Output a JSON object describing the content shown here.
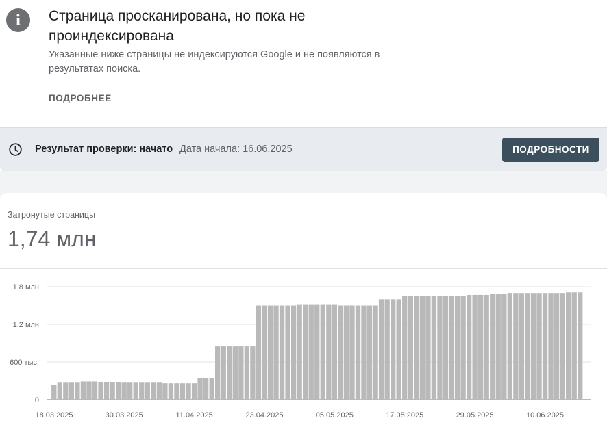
{
  "notice": {
    "title": "Страница просканирована, но пока не проиндексирована",
    "description": "Указанные ниже страницы не индексируются Google и не появляются в результатах поиска.",
    "more_link": "ПОДРОБНЕЕ",
    "icon": "info-icon"
  },
  "validation": {
    "status_label": "Результат проверки: начато",
    "start_date": "Дата начала: 16.06.2025",
    "details_button": "ПОДРОБНОСТИ",
    "icon": "clock-icon"
  },
  "metric": {
    "label": "Затронутые страницы",
    "value": "1,74 млн"
  },
  "colors": {
    "bar": "#b9b9b9",
    "button": "#3c4f5d",
    "status_bg": "#e8ebef"
  },
  "chart_data": {
    "type": "bar",
    "title": "",
    "xlabel": "",
    "ylabel": "",
    "ylim": [
      0,
      1800000
    ],
    "grid": true,
    "y_ticks": [
      {
        "value": 0,
        "label": "0"
      },
      {
        "value": 600000,
        "label": "600 тыс."
      },
      {
        "value": 1200000,
        "label": "1,2 млн"
      },
      {
        "value": 1800000,
        "label": "1,8 млн"
      }
    ],
    "x_tick_labels": [
      {
        "index": 0,
        "label": "18.03.2025"
      },
      {
        "index": 12,
        "label": "30.03.2025"
      },
      {
        "index": 24,
        "label": "11.04.2025"
      },
      {
        "index": 36,
        "label": "23.04.2025"
      },
      {
        "index": 48,
        "label": "05.05.2025"
      },
      {
        "index": 60,
        "label": "17.05.2025"
      },
      {
        "index": 72,
        "label": "29.05.2025"
      },
      {
        "index": 84,
        "label": "10.06.2025"
      }
    ],
    "series": [
      {
        "values": [
          240000,
          270000,
          270000,
          270000,
          270000,
          290000,
          290000,
          290000,
          280000,
          280000,
          280000,
          280000,
          270000,
          270000,
          270000,
          270000,
          270000,
          270000,
          270000,
          260000,
          260000,
          260000,
          260000,
          260000,
          260000,
          340000,
          340000,
          340000,
          850000,
          850000,
          850000,
          850000,
          850000,
          850000,
          850000,
          1500000,
          1500000,
          1500000,
          1500000,
          1500000,
          1500000,
          1500000,
          1510000,
          1510000,
          1510000,
          1510000,
          1510000,
          1510000,
          1510000,
          1500000,
          1500000,
          1500000,
          1500000,
          1500000,
          1500000,
          1500000,
          1600000,
          1600000,
          1600000,
          1600000,
          1650000,
          1650000,
          1650000,
          1650000,
          1650000,
          1650000,
          1650000,
          1650000,
          1650000,
          1650000,
          1650000,
          1670000,
          1670000,
          1670000,
          1670000,
          1690000,
          1690000,
          1690000,
          1700000,
          1700000,
          1700000,
          1700000,
          1700000,
          1700000,
          1700000,
          1700000,
          1700000,
          1700000,
          1710000,
          1710000,
          1710000
        ]
      }
    ]
  }
}
